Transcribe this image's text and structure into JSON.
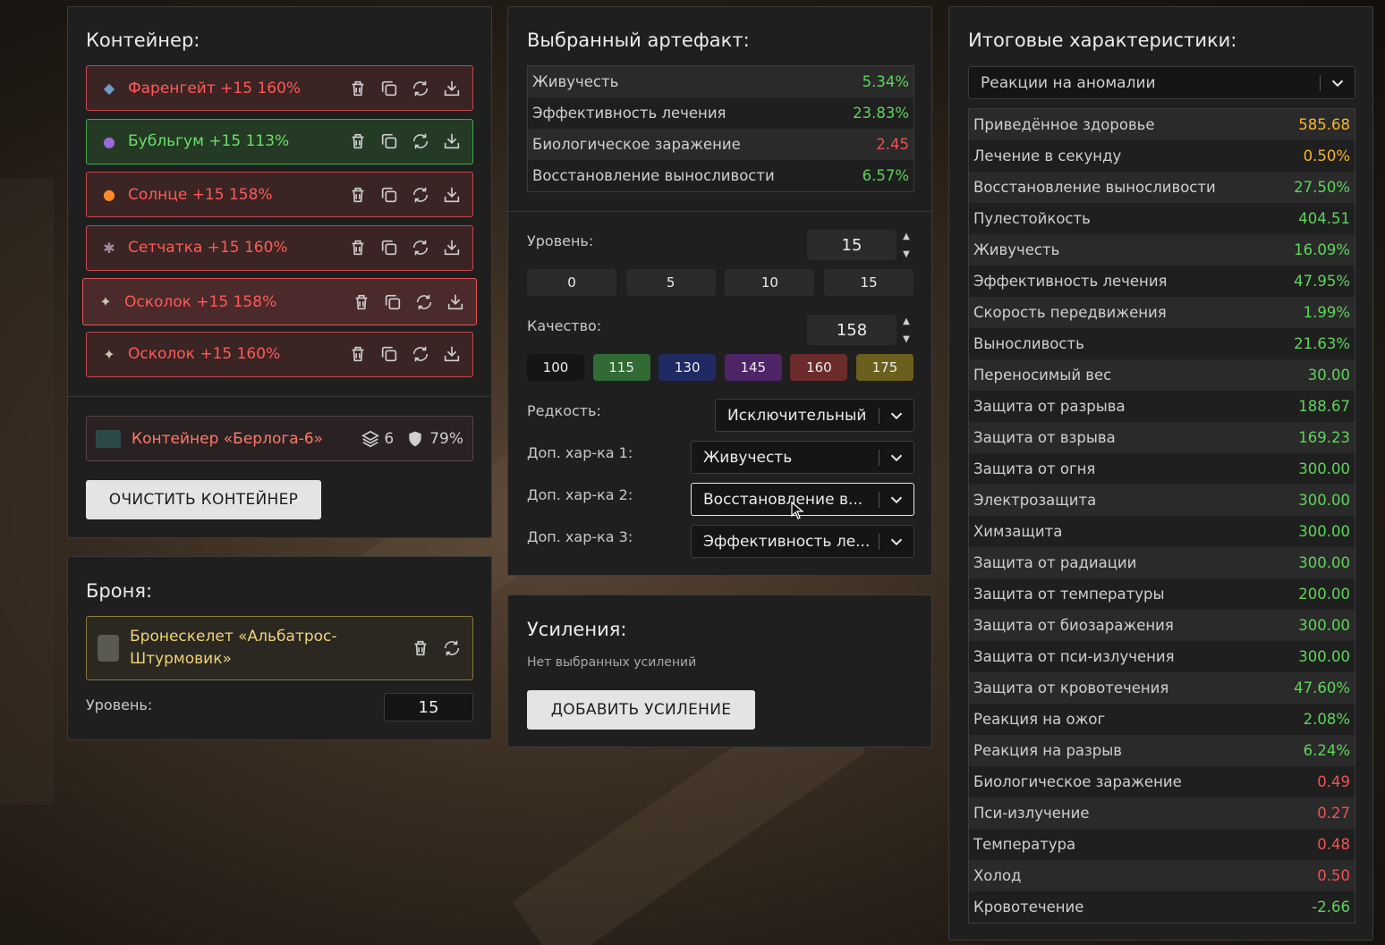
{
  "container_panel": {
    "title": "Контейнер:",
    "items": [
      {
        "name": "Фаренгейт +15 160%",
        "style": "red",
        "icon": "fahrenheit-icon",
        "glyph": "◆"
      },
      {
        "name": "Бубльгум +15 113%",
        "style": "green",
        "icon": "bubblegum-icon",
        "glyph": "●"
      },
      {
        "name": "Солнце +15 158%",
        "style": "red",
        "icon": "sun-icon",
        "glyph": "●"
      },
      {
        "name": "Сетчатка +15 160%",
        "style": "red",
        "icon": "retina-icon",
        "glyph": "✱"
      },
      {
        "name": "Осколок +15 158%",
        "style": "sel",
        "icon": "shard-icon",
        "glyph": "✦"
      },
      {
        "name": "Осколок +15 160%",
        "style": "red",
        "icon": "shard-icon",
        "glyph": "✦"
      }
    ],
    "container_item": {
      "name": "Контейнер «Берлога-6»",
      "slots": "6",
      "protection": "79%"
    },
    "clear_button": "ОЧИСТИТЬ КОНТЕЙНЕР"
  },
  "armor_panel": {
    "title": "Броня:",
    "armor_name": "Бронескелет «Альбатрос-Штурмовик»",
    "level_label": "Уровень:",
    "level_value": "15"
  },
  "artifact_panel": {
    "title": "Выбранный артефакт:",
    "stats": [
      {
        "label": "Живучесть",
        "value": "5.34%",
        "color": "green"
      },
      {
        "label": "Эффективность лечения",
        "value": "23.83%",
        "color": "green"
      },
      {
        "label": "Биологическое заражение",
        "value": "2.45",
        "color": "red"
      },
      {
        "label": "Восстановление выносливости",
        "value": "6.57%",
        "color": "green"
      }
    ],
    "level_label": "Уровень:",
    "level_value": "15",
    "level_presets": [
      "0",
      "5",
      "10",
      "15"
    ],
    "quality_label": "Качество:",
    "quality_value": "158",
    "quality_presets": [
      {
        "label": "100",
        "color": "#151515"
      },
      {
        "label": "115",
        "color": "#2f6b32"
      },
      {
        "label": "130",
        "color": "#1f2a63"
      },
      {
        "label": "145",
        "color": "#4d2466"
      },
      {
        "label": "160",
        "color": "#6b2b2b"
      },
      {
        "label": "175",
        "color": "#6b5f1e"
      }
    ],
    "rarity_label": "Редкость:",
    "rarity_value": "Исключительный",
    "extra1_label": "Доп. хар-ка 1:",
    "extra1_value": "Живучесть",
    "extra2_label": "Доп. хар-ка 2:",
    "extra2_value": "Восстановление в...",
    "extra3_label": "Доп. хар-ка 3:",
    "extra3_value": "Эффективность ле..."
  },
  "boost_panel": {
    "title": "Усиления:",
    "empty_text": "Нет выбранных усилений",
    "add_button": "ДОБАВИТЬ УСИЛЕНИЕ"
  },
  "totals_panel": {
    "title": "Итоговые характеристики:",
    "filter_value": "Реакции на аномалии",
    "stats": [
      {
        "label": "Приведённое здоровье",
        "value": "585.68",
        "color": "orange"
      },
      {
        "label": "Лечение в секунду",
        "value": "0.50%",
        "color": "orange"
      },
      {
        "label": "Восстановление выносливости",
        "value": "27.50%",
        "color": "green"
      },
      {
        "label": "Пулестойкость",
        "value": "404.51",
        "color": "green"
      },
      {
        "label": "Живучесть",
        "value": "16.09%",
        "color": "green"
      },
      {
        "label": "Эффективность лечения",
        "value": "47.95%",
        "color": "green"
      },
      {
        "label": "Скорость передвижения",
        "value": "1.99%",
        "color": "green"
      },
      {
        "label": "Выносливость",
        "value": "21.63%",
        "color": "green"
      },
      {
        "label": "Переносимый вес",
        "value": "30.00",
        "color": "green"
      },
      {
        "label": "Защита от разрыва",
        "value": "188.67",
        "color": "green"
      },
      {
        "label": "Защита от взрыва",
        "value": "169.23",
        "color": "green"
      },
      {
        "label": "Защита от огня",
        "value": "300.00",
        "color": "green"
      },
      {
        "label": "Электрозащита",
        "value": "300.00",
        "color": "green"
      },
      {
        "label": "Химзащита",
        "value": "300.00",
        "color": "green"
      },
      {
        "label": "Защита от радиации",
        "value": "300.00",
        "color": "green"
      },
      {
        "label": "Защита от температуры",
        "value": "200.00",
        "color": "green"
      },
      {
        "label": "Защита от биозаражения",
        "value": "300.00",
        "color": "green"
      },
      {
        "label": "Защита от пси-излучения",
        "value": "300.00",
        "color": "green"
      },
      {
        "label": "Защита от кровотечения",
        "value": "47.60%",
        "color": "green"
      },
      {
        "label": "Реакция на ожог",
        "value": "2.08%",
        "color": "green"
      },
      {
        "label": "Реакция на разрыв",
        "value": "6.24%",
        "color": "green"
      },
      {
        "label": "Биологическое заражение",
        "value": "0.49",
        "color": "red"
      },
      {
        "label": "Пси-излучение",
        "value": "0.27",
        "color": "red"
      },
      {
        "label": "Температура",
        "value": "0.48",
        "color": "red"
      },
      {
        "label": "Холод",
        "value": "0.50",
        "color": "red"
      },
      {
        "label": "Кровотечение",
        "value": "-2.66",
        "color": "green"
      }
    ]
  }
}
